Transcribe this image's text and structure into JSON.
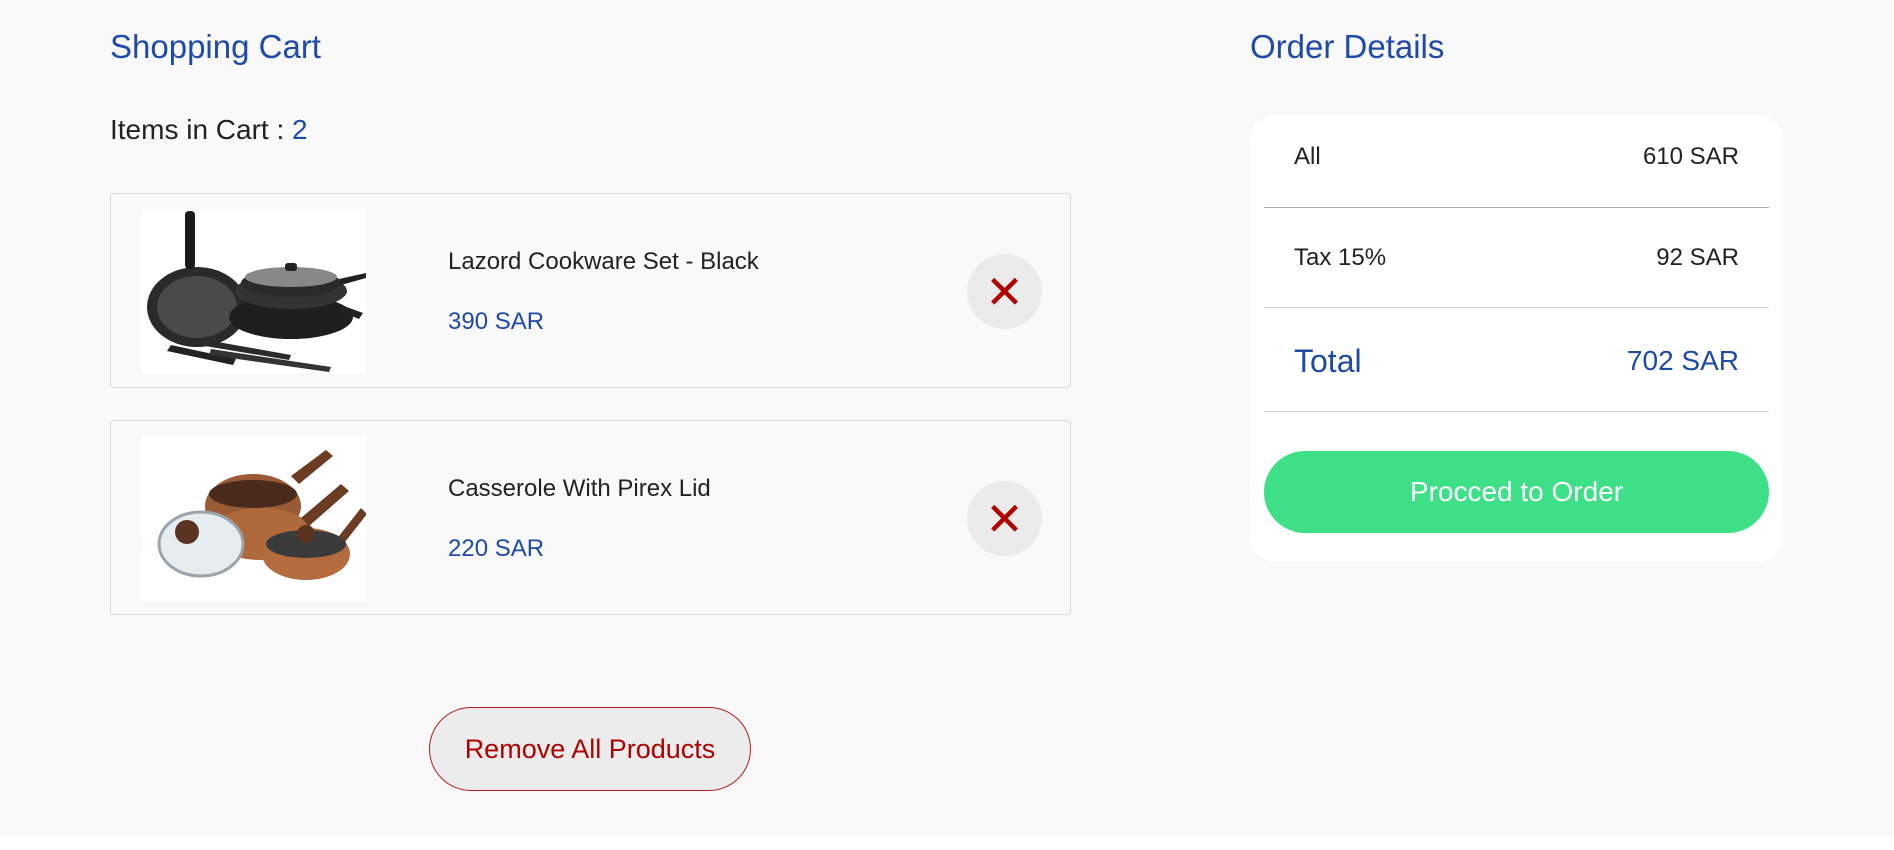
{
  "cart": {
    "title": "Shopping Cart",
    "items_label": "Items in Cart :",
    "items_count": "2",
    "items": [
      {
        "name": "Lazord Cookware Set - Black",
        "price": "390 SAR",
        "image": "black-cookware-set"
      },
      {
        "name": "Casserole With Pirex Lid",
        "price": "220 SAR",
        "image": "copper-casserole-set"
      }
    ],
    "remove_icon": "close-icon",
    "remove_all_label": "Remove All Products"
  },
  "order": {
    "title": "Order Details",
    "all_label": "All",
    "all_value": "610 SAR",
    "tax_label": "Tax 15%",
    "tax_value": "92 SAR",
    "total_label": "Total",
    "total_value": "702 SAR",
    "proceed_label": "Procced to Order"
  },
  "colors": {
    "accent_blue": "#1f4aa8",
    "danger_red": "#b00000",
    "proceed_green": "#3ddf87",
    "background": "#f9f9f9"
  }
}
